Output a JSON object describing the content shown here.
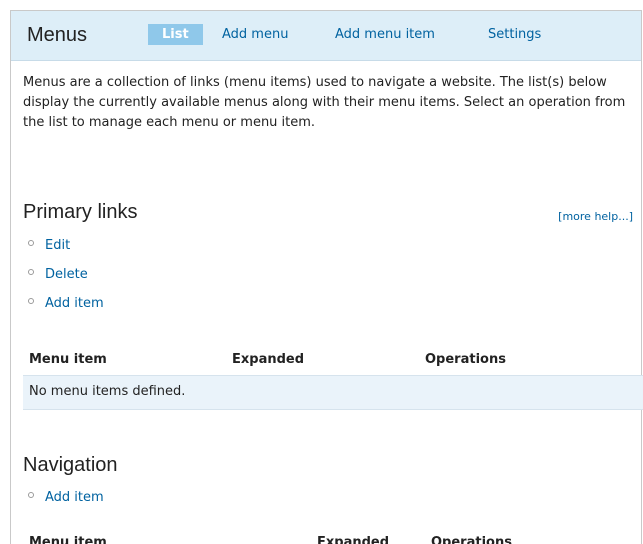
{
  "header": {
    "title": "Menus",
    "tabs": [
      {
        "label": "List",
        "active": true
      },
      {
        "label": "Add menu",
        "active": false
      },
      {
        "label": "Add menu item",
        "active": false
      },
      {
        "label": "Settings",
        "active": false
      }
    ]
  },
  "intro_text": "Menus are a collection of links (menu items) used to navigate a website. The list(s) below display the currently available menus along with their menu items. Select an operation from the list to manage each menu or menu item.",
  "more_help": "[more help...]",
  "menus": [
    {
      "title": "Primary links",
      "operations": [
        "Edit",
        "Delete",
        "Add item"
      ],
      "table": {
        "headers": [
          "Menu item",
          "Expanded",
          "Operations"
        ],
        "empty_message": "No menu items defined."
      }
    },
    {
      "title": "Navigation",
      "operations": [
        "Add item"
      ],
      "table": {
        "headers": [
          "Menu item",
          "Expanded",
          "Operations"
        ]
      }
    }
  ],
  "colors": {
    "link": "#0062a0",
    "tabbar_bg": "#ddeef8",
    "active_tab_bg": "#8fc8ea",
    "empty_row_bg": "#eaf3fa"
  }
}
